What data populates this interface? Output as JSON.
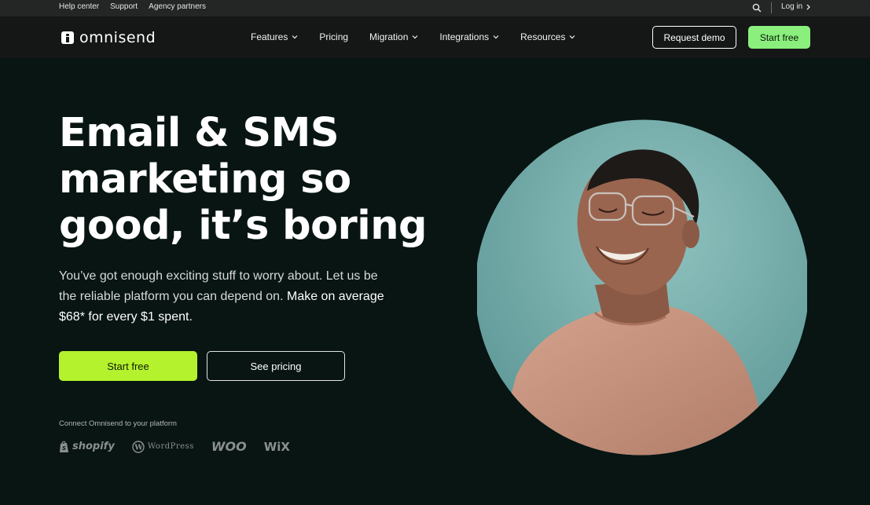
{
  "topbar": {
    "links": [
      "Help center",
      "Support",
      "Agency partners"
    ],
    "login_label": "Log in"
  },
  "nav": {
    "logo_text": "omnisend",
    "menu": [
      {
        "label": "Features",
        "dropdown": true
      },
      {
        "label": "Pricing",
        "dropdown": false
      },
      {
        "label": "Migration",
        "dropdown": true
      },
      {
        "label": "Integrations",
        "dropdown": true
      },
      {
        "label": "Resources",
        "dropdown": true
      }
    ],
    "request_demo_label": "Request demo",
    "start_free_label": "Start free"
  },
  "hero": {
    "headline_lines": [
      "Email & SMS",
      "marketing so",
      "good, it’s boring"
    ],
    "sub_plain": "You’ve got enough exciting stuff to worry about. Let us be the reliable platform you can depend on.",
    "sub_strong": "Make on average $68* for every $1 spent.",
    "cta_start_label": "Start free",
    "cta_pricing_label": "See pricing",
    "connect_label": "Connect Omnisend to your platform",
    "platforms": [
      "shopify",
      "WordPress",
      "WOO",
      "WiX"
    ]
  },
  "colors": {
    "page_bg": "#081513",
    "nav_bg": "#151717",
    "accent_lime": "#b4f22d",
    "accent_green": "#8aef7c",
    "portrait_bg": "#6fa6a4"
  },
  "icons": {
    "search": "search-icon",
    "login_chevron": "chevron-right-icon",
    "menu_chevron": "chevron-down-icon"
  }
}
